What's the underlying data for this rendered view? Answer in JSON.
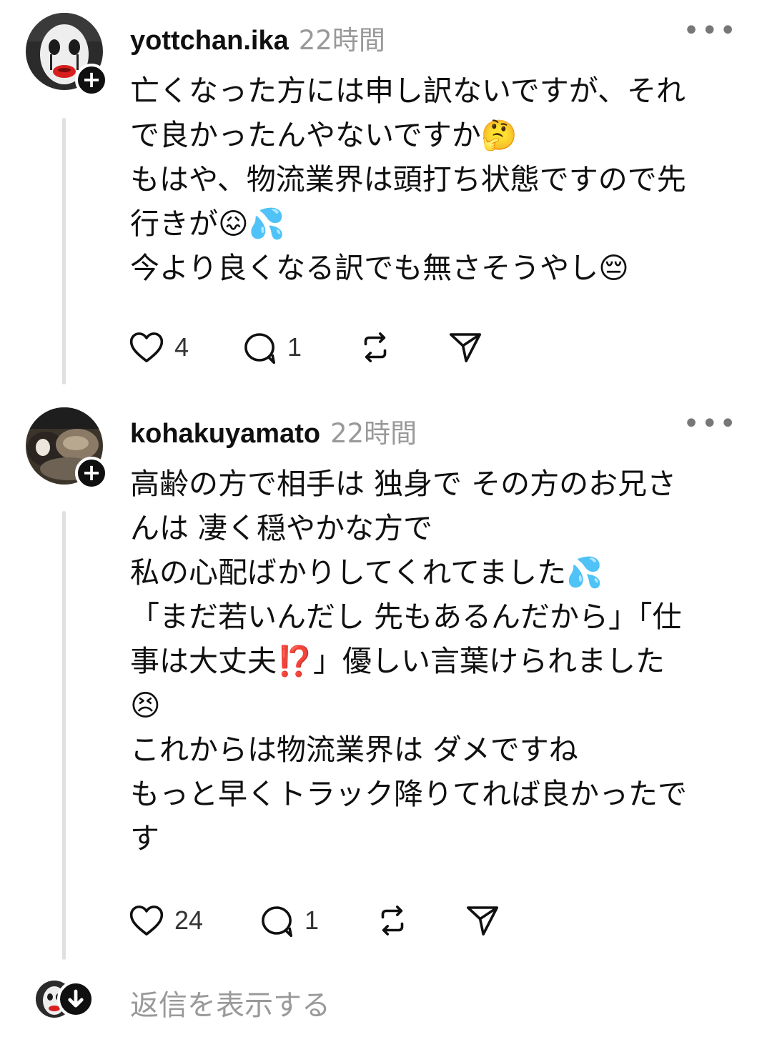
{
  "posts": [
    {
      "username": "yottchan.ika",
      "timestamp": "22時間",
      "more_label": "•••",
      "follow_label": "+",
      "lines": [
        "亡くなった方には申し訳ないですが、それ",
        "で良かったんやないですか🤔",
        "もはや、物流業界は頭打ち状態ですので先",
        "行きが😖💦",
        "今より良くなる訳でも無さそうやし😔"
      ],
      "likes": "4",
      "replies": "1",
      "avatar_icon": "clown-face-avatar"
    },
    {
      "username": "kohakuyamato",
      "timestamp": "22時間",
      "more_label": "•••",
      "follow_label": "+",
      "lines": [
        "高齢の方で相手は 独身で その方のお兄さ",
        "んは 凄く穏やかな方で",
        "私の心配ばかりしてくれてました💦",
        "「まだ若いんだし 先もあるんだから」「仕",
        "事は大丈夫⁉️」優しい言葉けられました",
        "😣",
        "これからは物流業界は ダメですね",
        "もっと早くトラック降りてれば良かったで",
        "す"
      ],
      "likes": "24",
      "replies": "1",
      "avatar_icon": "cat-photo-avatar"
    }
  ],
  "show_replies": {
    "label": "返信を表示する"
  },
  "icons": {
    "like": "heart-icon",
    "reply": "comment-icon",
    "repost": "repost-icon",
    "share": "send-icon",
    "expand": "arrow-down-icon"
  },
  "colors": {
    "text": "#101010",
    "muted": "#999999",
    "thread_line": "#e0e0e0",
    "badge": "#101010"
  }
}
